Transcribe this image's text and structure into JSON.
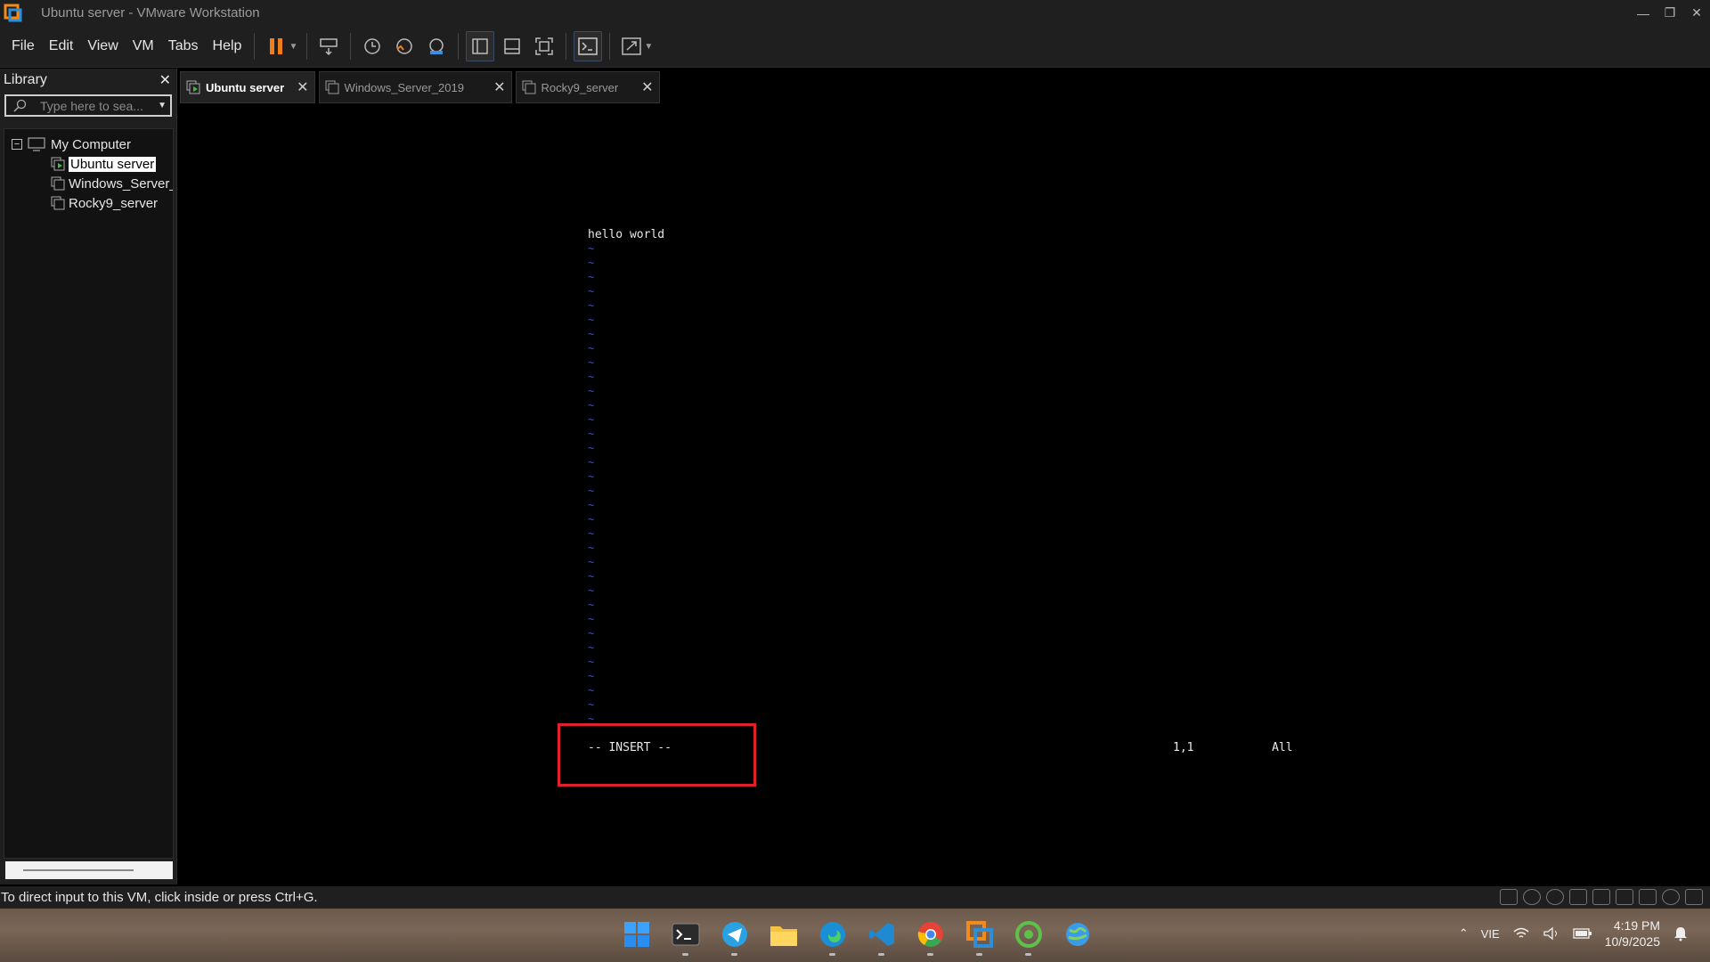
{
  "window": {
    "title": "Ubuntu server - VMware Workstation",
    "controls": [
      "minimize-icon",
      "restore-icon",
      "close-icon"
    ]
  },
  "menu": [
    "File",
    "Edit",
    "View",
    "VM",
    "Tabs",
    "Help"
  ],
  "library": {
    "title": "Library",
    "search_placeholder": "Type here to sea...",
    "root": "My Computer",
    "items": [
      {
        "label": "Ubuntu server",
        "selected": true
      },
      {
        "label": "Windows_Server_"
      },
      {
        "label": "Rocky9_server"
      }
    ]
  },
  "tabs": [
    {
      "label": "Ubuntu server",
      "active": true
    },
    {
      "label": "Windows_Server_2019"
    },
    {
      "label": "Rocky9_server"
    }
  ],
  "console": {
    "first_line": "hello world",
    "tilde": "~",
    "mode": "-- INSERT --",
    "position": "1,1",
    "scope": "All"
  },
  "statusbar": {
    "message": "To direct input to this VM, click inside or press Ctrl+G."
  },
  "taskbar": {
    "apps": [
      "windows-start-icon",
      "terminal-icon",
      "telegram-icon",
      "file-explorer-icon",
      "edge-icon",
      "vscode-icon",
      "chrome-icon",
      "vmware-icon",
      "coccoc-icon",
      "globe-app-icon"
    ],
    "language": "VIE",
    "time": "4:19 PM",
    "date": "10/9/2025"
  },
  "colors": {
    "accent_orange": "#f07c1c",
    "highlight_red": "#e0202b",
    "vim_tilde_blue": "#3b4fd9"
  }
}
